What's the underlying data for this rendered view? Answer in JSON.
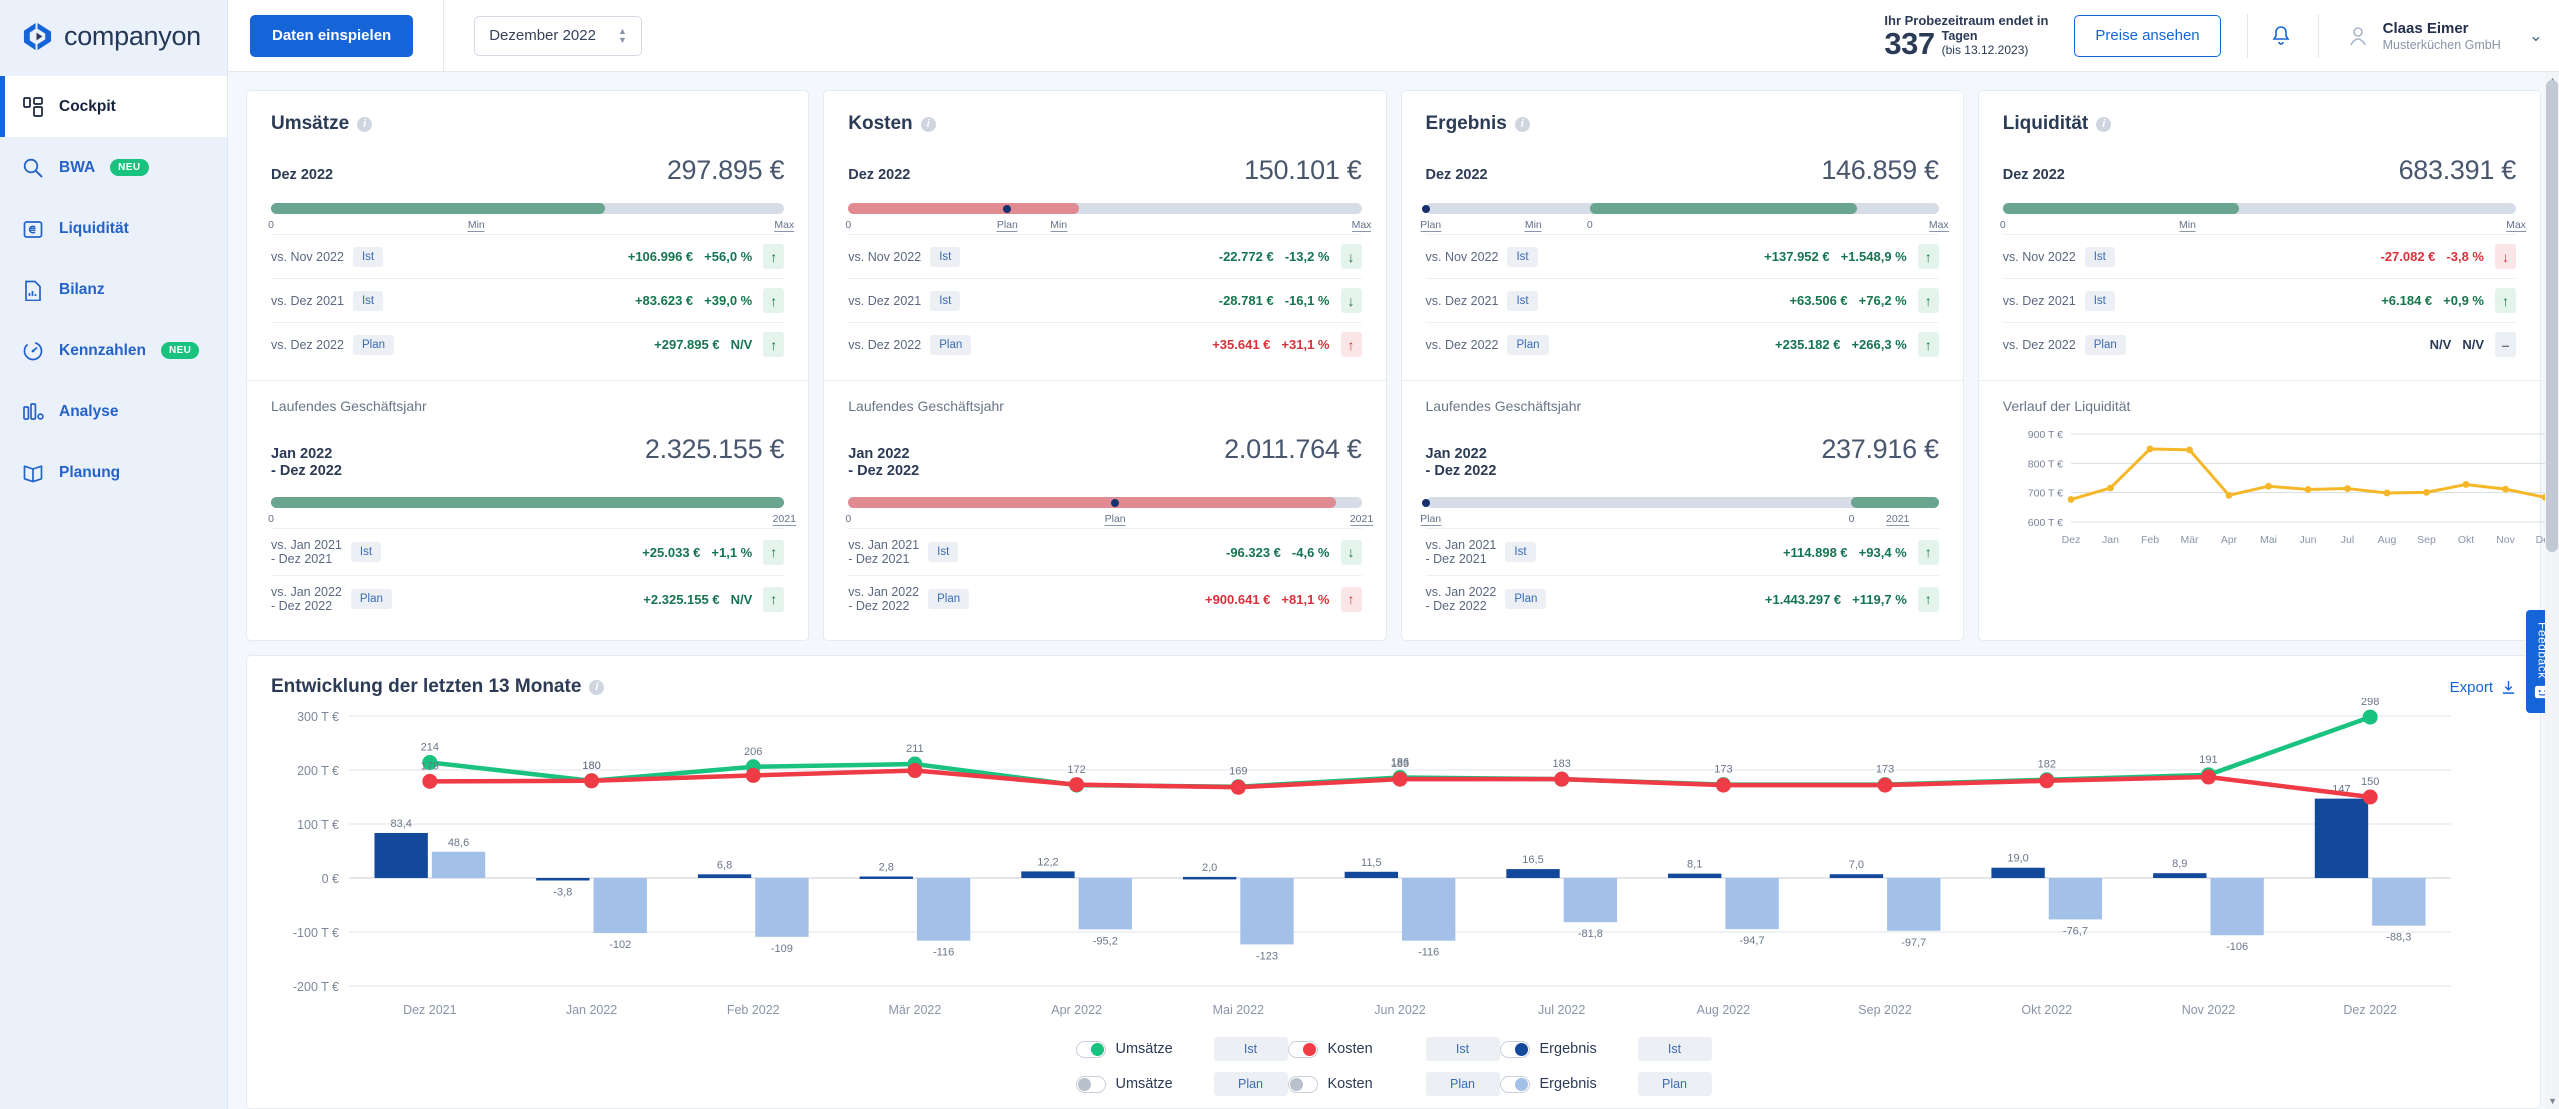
{
  "brand": {
    "name": "companyon",
    "accent": "#1565d8"
  },
  "sidebar": {
    "items": [
      {
        "label": "Cockpit",
        "icon": "grid-icon",
        "badge": null,
        "active": true
      },
      {
        "label": "BWA",
        "icon": "search-icon",
        "badge": "NEU",
        "active": false
      },
      {
        "label": "Liquidität",
        "icon": "euro-card-icon",
        "badge": null,
        "active": false
      },
      {
        "label": "Bilanz",
        "icon": "document-chart-icon",
        "badge": null,
        "active": false
      },
      {
        "label": "Kennzahlen",
        "icon": "gauge-icon",
        "badge": "NEU",
        "active": false
      },
      {
        "label": "Analyse",
        "icon": "bar-chart-icon",
        "badge": null,
        "active": false
      },
      {
        "label": "Planung",
        "icon": "book-icon",
        "badge": null,
        "active": false
      }
    ]
  },
  "topbar": {
    "import_button": "Daten einspielen",
    "period_select": "Dezember 2022",
    "trial_title": "Ihr Probezeitraum endet in",
    "trial_days": "337",
    "trial_days_unit": "Tagen",
    "trial_until": "(bis 13.12.2023)",
    "pricing_button": "Preise ansehen",
    "bell_icon": "bell-icon",
    "user_name": "Claas Eimer",
    "user_org": "Musterküchen GmbH",
    "chevron": "chevron-down-icon"
  },
  "cards": [
    {
      "title": "Umsätze",
      "month": {
        "period": "Dez 2022",
        "value": "297.895 €"
      },
      "month_bar": {
        "fill_pct": 65,
        "color": "#6aa58f",
        "dot_pct": null,
        "ticks": [
          {
            "label": "0",
            "pos": 0,
            "u": false
          },
          {
            "label": "Min",
            "pos": 40,
            "u": true
          },
          {
            "label": "Max",
            "pos": 100,
            "u": true
          }
        ]
      },
      "month_rows": [
        {
          "label": "vs. Nov 2022",
          "pill": "Ist",
          "amount": "+106.996 €",
          "pct": "+56,0 %",
          "tone": "pos",
          "arrow": "↑",
          "arrow_tone": "up-g"
        },
        {
          "label": "vs. Dez 2021",
          "pill": "Ist",
          "amount": "+83.623 €",
          "pct": "+39,0 %",
          "tone": "pos",
          "arrow": "↑",
          "arrow_tone": "up-g"
        },
        {
          "label": "vs. Dez 2022",
          "pill": "Plan",
          "amount": "+297.895 €",
          "pct": "N/V",
          "tone": "pos",
          "arrow": "↑",
          "arrow_tone": "up-g"
        }
      ],
      "year_label": "Laufendes Geschäftsjahr",
      "year": {
        "period": "Jan 2022\n- Dez 2022",
        "value": "2.325.155 €"
      },
      "year_bar": {
        "fill_pct": 100,
        "color": "#6aa58f",
        "dot_pct": null,
        "ticks": [
          {
            "label": "0",
            "pos": 0,
            "u": false
          },
          {
            "label": "2021",
            "pos": 100,
            "u": true
          }
        ]
      },
      "year_rows": [
        {
          "label": "vs. Jan 2021\n- Dez 2021",
          "pill": "Ist",
          "amount": "+25.033 €",
          "pct": "+1,1 %",
          "tone": "pos",
          "arrow": "↑",
          "arrow_tone": "up-g"
        },
        {
          "label": "vs. Jan 2022\n- Dez 2022",
          "pill": "Plan",
          "amount": "+2.325.155 €",
          "pct": "N/V",
          "tone": "pos",
          "arrow": "↑",
          "arrow_tone": "up-g"
        }
      ]
    },
    {
      "title": "Kosten",
      "month": {
        "period": "Dez 2022",
        "value": "150.101 €"
      },
      "month_bar": {
        "fill_pct": 45,
        "color": "#df8b91",
        "dot_pct": 31,
        "ticks": [
          {
            "label": "0",
            "pos": 0,
            "u": false
          },
          {
            "label": "Plan",
            "pos": 31,
            "u": true
          },
          {
            "label": "Min",
            "pos": 41,
            "u": true
          },
          {
            "label": "Max",
            "pos": 100,
            "u": true
          }
        ]
      },
      "month_rows": [
        {
          "label": "vs. Nov 2022",
          "pill": "Ist",
          "amount": "-22.772 €",
          "pct": "-13,2 %",
          "tone": "pos",
          "arrow": "↓",
          "arrow_tone": "dn-g"
        },
        {
          "label": "vs. Dez 2021",
          "pill": "Ist",
          "amount": "-28.781 €",
          "pct": "-16,1 %",
          "tone": "pos",
          "arrow": "↓",
          "arrow_tone": "dn-g"
        },
        {
          "label": "vs. Dez 2022",
          "pill": "Plan",
          "amount": "+35.641 €",
          "pct": "+31,1 %",
          "tone": "neg",
          "arrow": "↑",
          "arrow_tone": "up-r"
        }
      ],
      "year_label": "Laufendes Geschäftsjahr",
      "year": {
        "period": "Jan 2022\n- Dez 2022",
        "value": "2.011.764 €"
      },
      "year_bar": {
        "fill_pct": 95,
        "color": "#df8b91",
        "dot_pct": 52,
        "ticks": [
          {
            "label": "0",
            "pos": 0,
            "u": false
          },
          {
            "label": "Plan",
            "pos": 52,
            "u": true
          },
          {
            "label": "2021",
            "pos": 100,
            "u": true
          }
        ]
      },
      "year_rows": [
        {
          "label": "vs. Jan 2021\n- Dez 2021",
          "pill": "Ist",
          "amount": "-96.323 €",
          "pct": "-4,6 %",
          "tone": "pos",
          "arrow": "↓",
          "arrow_tone": "dn-g"
        },
        {
          "label": "vs. Jan 2022\n- Dez 2022",
          "pill": "Plan",
          "amount": "+900.641 €",
          "pct": "+81,1 %",
          "tone": "neg",
          "arrow": "↑",
          "arrow_tone": "up-r"
        }
      ]
    },
    {
      "title": "Ergebnis",
      "month": {
        "period": "Dez 2022",
        "value": "146.859 €"
      },
      "month_bar": {
        "fill_pct": 52,
        "fill_start_pct": 32,
        "color": "#6aa58f",
        "dot_pct": 0,
        "ticks": [
          {
            "label": "Plan",
            "pos": 1,
            "u": true
          },
          {
            "label": "Min",
            "pos": 21,
            "u": true
          },
          {
            "label": "0",
            "pos": 32,
            "u": false
          },
          {
            "label": "Max",
            "pos": 100,
            "u": true
          }
        ]
      },
      "month_rows": [
        {
          "label": "vs. Nov 2022",
          "pill": "Ist",
          "amount": "+137.952 €",
          "pct": "+1.548,9 %",
          "tone": "pos",
          "arrow": "↑",
          "arrow_tone": "up-g"
        },
        {
          "label": "vs. Dez 2021",
          "pill": "Ist",
          "amount": "+63.506 €",
          "pct": "+76,2 %",
          "tone": "pos",
          "arrow": "↑",
          "arrow_tone": "up-g"
        },
        {
          "label": "vs. Dez 2022",
          "pill": "Plan",
          "amount": "+235.182 €",
          "pct": "+266,3 %",
          "tone": "pos",
          "arrow": "↑",
          "arrow_tone": "up-g"
        }
      ],
      "year_label": "Laufendes Geschäftsjahr",
      "year": {
        "period": "Jan 2022\n- Dez 2022",
        "value": "237.916 €"
      },
      "year_bar": {
        "fill_pct": 17,
        "fill_start_pct": 83,
        "color": "#6aa58f",
        "dot_pct": 0,
        "ticks": [
          {
            "label": "Plan",
            "pos": 1,
            "u": true
          },
          {
            "label": "0",
            "pos": 83,
            "u": false
          },
          {
            "label": "2021",
            "pos": 92,
            "u": true
          }
        ]
      },
      "year_rows": [
        {
          "label": "vs. Jan 2021\n- Dez 2021",
          "pill": "Ist",
          "amount": "+114.898 €",
          "pct": "+93,4 %",
          "tone": "pos",
          "arrow": "↑",
          "arrow_tone": "up-g"
        },
        {
          "label": "vs. Jan 2022\n- Dez 2022",
          "pill": "Plan",
          "amount": "+1.443.297 €",
          "pct": "+119,7 %",
          "tone": "pos",
          "arrow": "↑",
          "arrow_tone": "up-g"
        }
      ]
    },
    {
      "title": "Liquidität",
      "month": {
        "period": "Dez 2022",
        "value": "683.391 €"
      },
      "month_bar": {
        "fill_pct": 46,
        "color": "#6aa58f",
        "dot_pct": null,
        "ticks": [
          {
            "label": "0",
            "pos": 0,
            "u": false
          },
          {
            "label": "Min",
            "pos": 36,
            "u": true
          },
          {
            "label": "Max",
            "pos": 100,
            "u": true
          }
        ]
      },
      "month_rows": [
        {
          "label": "vs. Nov 2022",
          "pill": "Ist",
          "amount": "-27.082 €",
          "pct": "-3,8 %",
          "tone": "neg",
          "arrow": "↓",
          "arrow_tone": "dn-r"
        },
        {
          "label": "vs. Dez 2021",
          "pill": "Ist",
          "amount": "+6.184 €",
          "pct": "+0,9 %",
          "tone": "pos",
          "arrow": "↑",
          "arrow_tone": "up-g"
        },
        {
          "label": "vs. Dez 2022",
          "pill": "Plan",
          "amount": "N/V",
          "pct": "N/V",
          "tone": "neu",
          "arrow": "–",
          "arrow_tone": "flat"
        }
      ],
      "chart_label": "Verlauf der Liquidität"
    }
  ],
  "liquidity_chart": {
    "type": "line",
    "title": "Verlauf der Liquidität",
    "categories": [
      "Dez",
      "Jan",
      "Feb",
      "Mär",
      "Apr",
      "Mai",
      "Jun",
      "Jul",
      "Aug",
      "Sep",
      "Okt",
      "Nov",
      "Dez"
    ],
    "values": [
      677,
      716,
      849,
      846,
      691,
      722,
      711,
      714,
      699,
      701,
      728,
      712,
      684
    ],
    "ylabel": "",
    "ytick_labels": [
      "900 T €",
      "800 T €",
      "700 T €",
      "600 T €"
    ],
    "ylim": [
      600,
      900
    ],
    "series_color": "#f5b728",
    "grid": true
  },
  "big_chart": {
    "title": "Entwicklung der letzten 13 Monate",
    "export_label": "Export",
    "export_icon": "download-icon",
    "chart_data": {
      "type": "bar",
      "title": "Entwicklung der letzten 13 Monate",
      "categories": [
        "Dez 2021",
        "Jan 2022",
        "Feb 2022",
        "Mär 2022",
        "Apr 2022",
        "Mai 2022",
        "Jun 2022",
        "Jul 2022",
        "Aug 2022",
        "Sep 2022",
        "Okt 2022",
        "Nov 2022",
        "Dez 2022"
      ],
      "ytick_labels": [
        "300 T €",
        "200 T €",
        "100 T €",
        "0 €",
        "-100 T €",
        "-200 T €"
      ],
      "ylim": [
        -200,
        300
      ],
      "grid": true,
      "series": [
        {
          "name": "Umsätze Ist",
          "type": "line",
          "color": "#19c27e",
          "values": [
            214,
            180,
            206,
            211,
            172,
            169,
            186,
            183,
            173,
            173,
            182,
            191,
            298
          ],
          "labels": [
            "214",
            "180",
            "206",
            "211",
            "172",
            "169",
            "186",
            "183",
            "173",
            "173",
            "182",
            "191",
            "298"
          ]
        },
        {
          "name": "Kosten Ist",
          "type": "line",
          "color": "#ee3b45",
          "values": [
            179,
            180,
            190,
            199,
            173,
            168,
            183,
            183,
            172,
            172,
            180,
            187,
            150
          ],
          "labels": [
            "179",
            "180",
            "",
            "",
            "",
            "",
            "183",
            "",
            "",
            "",
            "",
            "",
            "150"
          ]
        },
        {
          "name": "Ergebnis Ist",
          "type": "bar",
          "color": "#13499b",
          "values": [
            83.4,
            -3.8,
            6.8,
            2.8,
            12.2,
            2.0,
            11.5,
            16.5,
            8.1,
            7.0,
            19.0,
            8.9,
            147
          ],
          "labels": [
            "83,4",
            "-3,8",
            "6,8",
            "2,8",
            "12,2",
            "2,0",
            "11,5",
            "16,5",
            "8,1",
            "7,0",
            "19,0",
            "8,9",
            "147"
          ]
        },
        {
          "name": "Ergebnis Plan",
          "type": "bar",
          "color": "#a3c1e8",
          "values": [
            48.6,
            -102,
            -109,
            -116,
            -95.2,
            -123,
            -116,
            -81.8,
            -94.7,
            -97.7,
            -76.7,
            -106,
            -88.3
          ],
          "labels": [
            "48,6",
            "-102",
            "-109",
            "-116",
            "-95,2",
            "-123",
            "-116",
            "-81,8",
            "-94,7",
            "-97,7",
            "-76,7",
            "-106",
            "-88,3"
          ]
        }
      ]
    },
    "legend": [
      {
        "label": "Umsätze",
        "pill": "Ist",
        "on": true,
        "color": "#19c27e"
      },
      {
        "label": "Umsätze",
        "pill": "Plan",
        "on": false,
        "color": "#b9c1cd"
      },
      {
        "label": "Kosten",
        "pill": "Ist",
        "on": true,
        "color": "#ee3b45"
      },
      {
        "label": "Kosten",
        "pill": "Plan",
        "on": false,
        "color": "#b9c1cd"
      },
      {
        "label": "Ergebnis",
        "pill": "Ist",
        "on": true,
        "color": "#13499b"
      },
      {
        "label": "Ergebnis",
        "pill": "Plan",
        "on": true,
        "color": "#a3c1e8"
      }
    ]
  },
  "feedback": {
    "label": "Feedback",
    "icon": "smiley-icon"
  }
}
